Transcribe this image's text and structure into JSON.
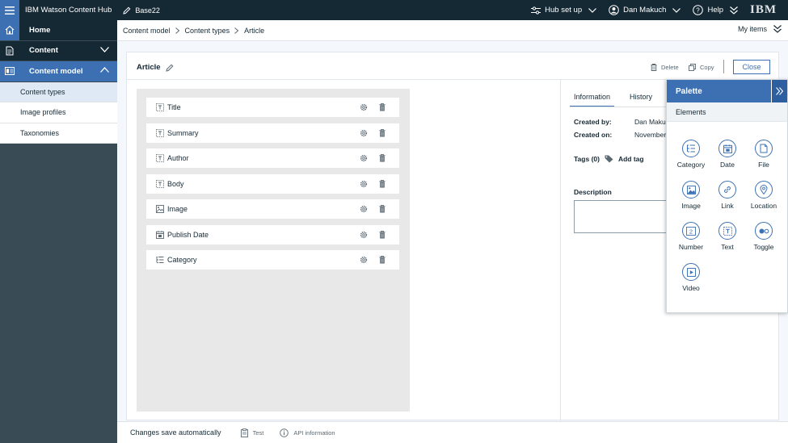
{
  "topbar": {
    "app_title": "IBM Watson Content Hub",
    "instance": "Base22",
    "hub_setup": "Hub set up",
    "user": "Dan Makuch",
    "help": "Help",
    "logo": "IBM"
  },
  "sidenav": {
    "home": "Home",
    "content": "Content",
    "content_model": "Content model",
    "sub_items": [
      "Content types",
      "Image profiles",
      "Taxonomies"
    ]
  },
  "breadcrumb": [
    "Content model",
    "Content types",
    "Article"
  ],
  "my_items": "My items",
  "content_type": {
    "name": "Article",
    "delete_label": "Delete",
    "copy_label": "Copy",
    "close_label": "Close"
  },
  "elements": [
    {
      "name": "Title",
      "icon": "text-icon"
    },
    {
      "name": "Summary",
      "icon": "text-icon"
    },
    {
      "name": "Author",
      "icon": "text-icon"
    },
    {
      "name": "Body",
      "icon": "text-icon"
    },
    {
      "name": "Image",
      "icon": "image-icon"
    },
    {
      "name": "Publish Date",
      "icon": "date-icon"
    },
    {
      "name": "Category",
      "icon": "category-icon"
    }
  ],
  "info_panel": {
    "tabs": [
      "Information",
      "History"
    ],
    "created_by_label": "Created by:",
    "created_by_value": "Dan Makuch",
    "created_on_label": "Created on:",
    "created_on_value": "November",
    "tags_label": "Tags (0)",
    "add_tag": "Add tag",
    "description_label": "Description"
  },
  "palette": {
    "title": "Palette",
    "section": "Elements",
    "items": [
      "Category",
      "Date",
      "File",
      "Image",
      "Link",
      "Location",
      "Number",
      "Text",
      "Toggle",
      "Video"
    ]
  },
  "footer": {
    "save_status": "Changes save automatically",
    "test": "Test",
    "api_info": "API information"
  },
  "colors": {
    "accent": "#3d70b2",
    "topbar": "#152935",
    "nav_bg": "#394b54"
  }
}
